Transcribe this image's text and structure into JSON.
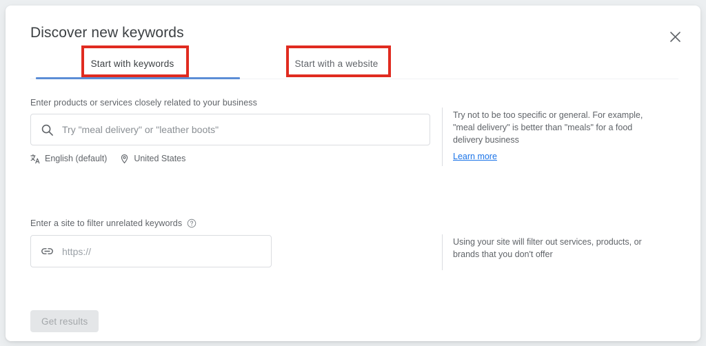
{
  "dialog": {
    "title": "Discover new keywords",
    "close_icon": "close-icon"
  },
  "tabs": [
    {
      "label": "Start with keywords",
      "selected": true,
      "annotated": true
    },
    {
      "label": "Start with a website",
      "selected": false,
      "annotated": true
    }
  ],
  "keywords_section": {
    "label": "Enter products or services closely related to your business",
    "search_icon": "search-icon",
    "input_value": "",
    "input_placeholder": "Try \"meal delivery\" or \"leather boots\"",
    "meta": [
      {
        "icon": "translate-icon",
        "label": "English (default)"
      },
      {
        "icon": "location-pin-icon",
        "label": "United States"
      }
    ],
    "helper_text": "Try not to be too specific or general. For example, \"meal delivery\" is better than \"meals\" for a food delivery business",
    "learn_more_label": "Learn more"
  },
  "site_section": {
    "label": "Enter a site to filter unrelated keywords",
    "help_icon": "help-circle-icon",
    "link_icon": "link-icon",
    "input_value": "",
    "input_placeholder": "https://",
    "helper_text": "Using your site will filter out services, products, or brands that you don't offer"
  },
  "footer": {
    "get_results_label": "Get results",
    "get_results_disabled": true
  },
  "colors": {
    "page_background": "#eceff1",
    "card_background": "#ffffff",
    "tab_indicator_blue": "#5b8dd6",
    "link_blue": "#1a73e8",
    "annotation_red": "#e02b20",
    "text_primary": "#3c4043",
    "text_secondary": "#5f6368",
    "border": "#dadce0",
    "disabled_button_bg": "#e4e6e8",
    "disabled_button_text": "#a3a7aa"
  }
}
